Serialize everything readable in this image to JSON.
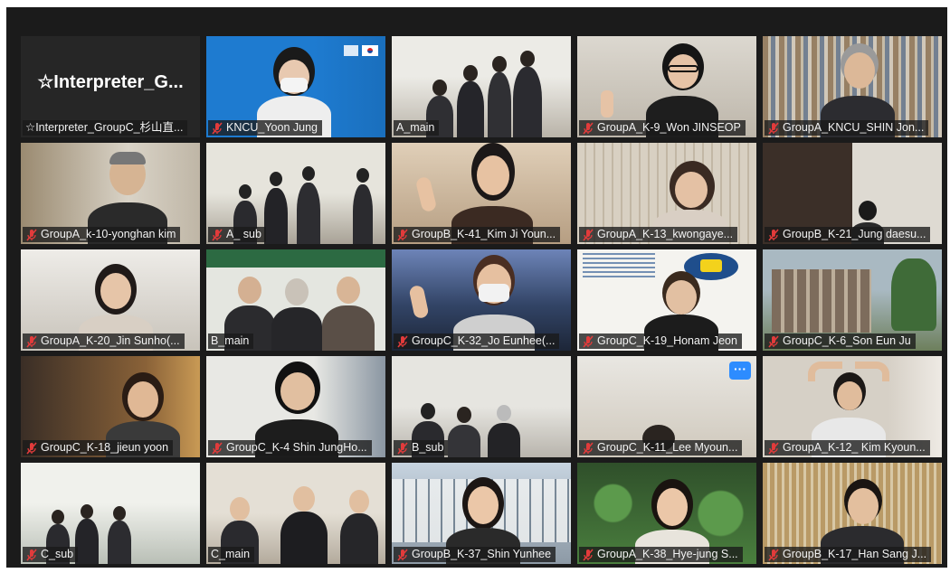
{
  "participants": [
    {
      "label": "☆Interpreter_GroupC_杉山直...",
      "display_name": "☆Interpreter_G...",
      "mic": "none"
    },
    {
      "label": "KNCU_Yoon Jung",
      "mic": "muted"
    },
    {
      "label": "A_main",
      "mic": "none",
      "active": true
    },
    {
      "label": "GroupA_K-9_Won JINSEOP",
      "mic": "muted"
    },
    {
      "label": "GroupA_KNCU_SHIN Jon...",
      "mic": "muted"
    },
    {
      "label": "GroupA_k-10-yonghan kim",
      "mic": "muted"
    },
    {
      "label": "A_ sub",
      "mic": "muted"
    },
    {
      "label": "GroupB_K-41_Kim Ji Youn...",
      "mic": "muted"
    },
    {
      "label": "GroupA_K-13_kwongaye...",
      "mic": "muted"
    },
    {
      "label": "GroupB_K-21_Jung daesu...",
      "mic": "muted"
    },
    {
      "label": "GroupA_K-20_Jin Sunho(...",
      "mic": "muted"
    },
    {
      "label": "B_main",
      "mic": "none"
    },
    {
      "label": "GroupC_K-32_Jo Eunhee(...",
      "mic": "muted"
    },
    {
      "label": "GroupC_K-19_Honam Jeon",
      "mic": "muted"
    },
    {
      "label": "GroupC_K-6_Son Eun Ju",
      "mic": "muted"
    },
    {
      "label": "GroupC_K-18_jieun yoon",
      "mic": "muted"
    },
    {
      "label": "GroupC_K-4 Shin JungHo...",
      "mic": "muted"
    },
    {
      "label": "B_sub",
      "mic": "muted"
    },
    {
      "label": "GroupC_K-11_Lee Myoun...",
      "mic": "muted",
      "more_button": "···"
    },
    {
      "label": "GroupA_K-12_ Kim Kyoun...",
      "mic": "muted"
    },
    {
      "label": "C_sub",
      "mic": "muted"
    },
    {
      "label": "C_main",
      "mic": "none"
    },
    {
      "label": "GroupB_K-37_Shin Yunhee",
      "mic": "muted"
    },
    {
      "label": "GroupA_K-38_Hye-jung S...",
      "mic": "muted"
    },
    {
      "label": "GroupB_K-17_Han Sang J...",
      "mic": "muted"
    }
  ],
  "colors": {
    "active_border": "#c9e336",
    "muted_icon": "#e23b3b",
    "more_button": "#2d8cff",
    "window_bg": "#1b1b1b"
  },
  "icons": {
    "muted": "microphone-muted-icon",
    "more": "more-options-icon"
  }
}
